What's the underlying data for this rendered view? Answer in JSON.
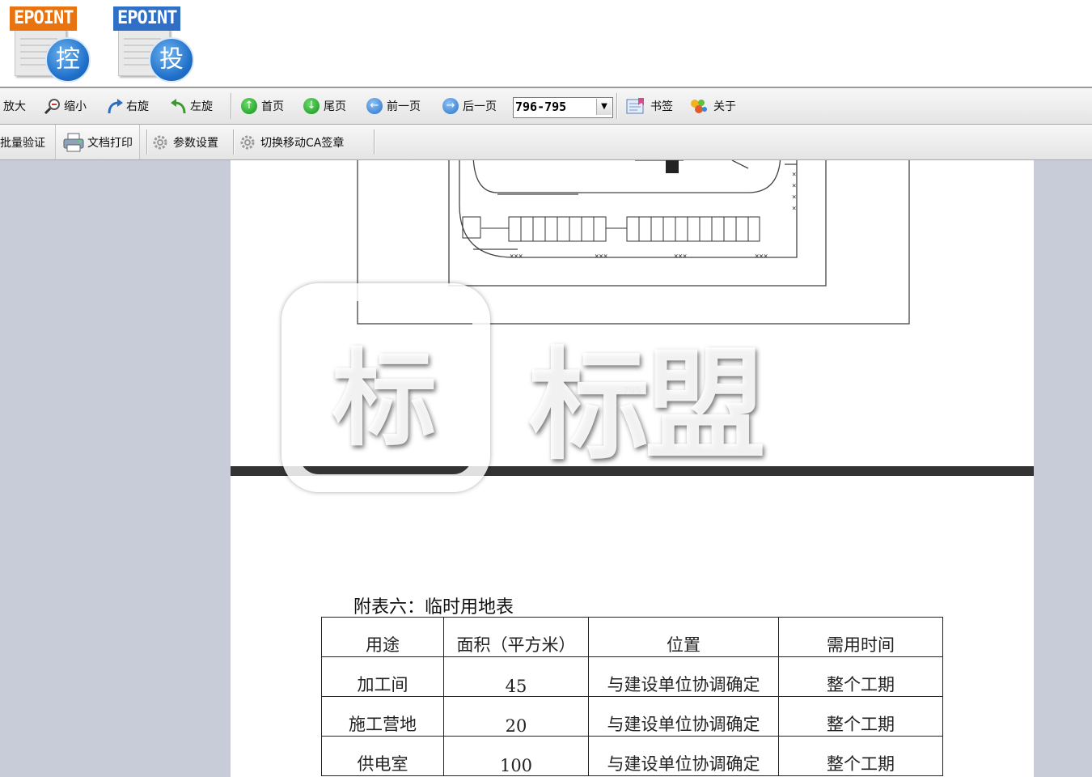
{
  "logos": [
    {
      "brand": "EPOINT",
      "glyph": "控",
      "brand_color": "#e8730f"
    },
    {
      "brand": "EPOINT",
      "glyph": "投",
      "brand_color": "#2f6fc6"
    }
  ],
  "toolbar1": {
    "zoom_in": "放大",
    "zoom_out": "缩小",
    "rotate_right": "右旋",
    "rotate_left": "左旋",
    "first_page": "首页",
    "last_page": "尾页",
    "prev_page": "前一页",
    "next_page": "后一页",
    "page_value": "796-795",
    "bookmark": "书签",
    "about": "关于"
  },
  "toolbar2": {
    "batch_verify": "批量验证",
    "print": "文档打印",
    "settings": "参数设置",
    "switch_ca": "切换移动CA签章"
  },
  "document": {
    "page_number": "795",
    "watermark_icon": "标",
    "watermark_text": "标盟",
    "table_title": "附表六：临时用地表",
    "table": {
      "headers": [
        "用途",
        "面积（平方米）",
        "位置",
        "需用时间"
      ],
      "rows": [
        [
          "加工间",
          "45",
          "与建设单位协调确定",
          "整个工期"
        ],
        [
          "施工营地",
          "20",
          "与建设单位协调确定",
          "整个工期"
        ],
        [
          "供电室",
          "100",
          "与建设单位协调确定",
          "整个工期"
        ]
      ]
    }
  }
}
